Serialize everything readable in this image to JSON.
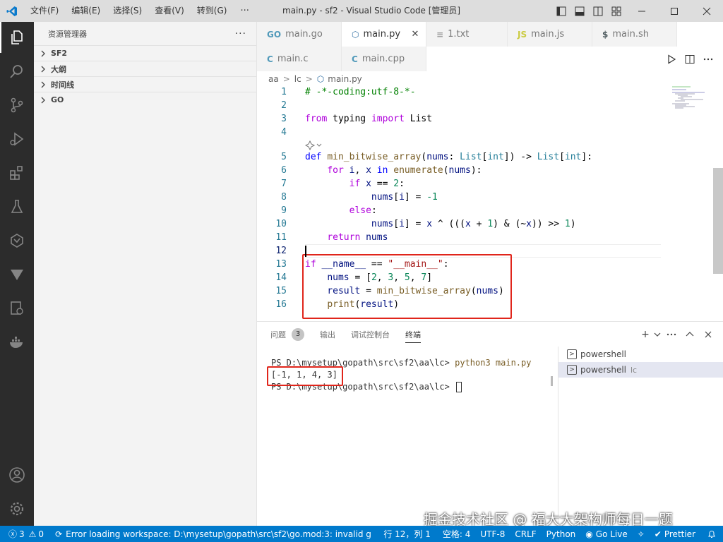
{
  "titlebar": {
    "menu": [
      "文件(F)",
      "编辑(E)",
      "选择(S)",
      "查看(V)",
      "转到(G)"
    ],
    "more": "···",
    "title": "main.py - sf2 - Visual Studio Code [管理员]"
  },
  "sidebar": {
    "title": "资源管理器",
    "more": "···",
    "sections": [
      "SF2",
      "大纲",
      "时间线",
      "GO"
    ]
  },
  "tabs": {
    "row1": [
      {
        "label": "main.go",
        "icon": "GO",
        "icon_color": "#519aba",
        "active": false
      },
      {
        "label": "main.py",
        "icon": "py",
        "icon_color": "#3572a5",
        "active": true
      },
      {
        "label": "1.txt",
        "icon": "≡",
        "icon_color": "#999999",
        "active": false
      },
      {
        "label": "main.js",
        "icon": "JS",
        "icon_color": "#cbcb41",
        "active": false
      },
      {
        "label": "main.sh",
        "icon": "$",
        "icon_color": "#4d5a5e",
        "active": false
      }
    ],
    "row2": [
      {
        "label": "main.c",
        "icon": "C",
        "icon_color": "#519aba",
        "active": false
      },
      {
        "label": "main.cpp",
        "icon": "C",
        "icon_color": "#519aba",
        "active": false
      }
    ]
  },
  "breadcrumb": [
    "aa",
    "lc",
    "main.py"
  ],
  "editor": {
    "lines": [
      {
        "n": "1",
        "tokens": [
          [
            "cmt",
            "# -*-coding:utf-8-*-"
          ]
        ]
      },
      {
        "n": "2",
        "tokens": []
      },
      {
        "n": "3",
        "tokens": [
          [
            "kw2",
            "from"
          ],
          [
            "",
            " typing "
          ],
          [
            "kw2",
            "import"
          ],
          [
            "",
            " List"
          ]
        ]
      },
      {
        "n": "4",
        "tokens": []
      },
      {
        "n": "5",
        "tokens": [
          [
            "kw",
            "def"
          ],
          [
            "",
            " "
          ],
          [
            "fn",
            "min_bitwise_array"
          ],
          [
            "",
            "("
          ],
          [
            "var",
            "nums"
          ],
          [
            "",
            ": "
          ],
          [
            "ty",
            "List"
          ],
          [
            "",
            "["
          ],
          [
            "ty",
            "int"
          ],
          [
            "",
            "]) -> "
          ],
          [
            "ty",
            "List"
          ],
          [
            "",
            "["
          ],
          [
            "ty",
            "int"
          ],
          [
            "",
            "]:"
          ]
        ]
      },
      {
        "n": "6",
        "tokens": [
          [
            "",
            "    "
          ],
          [
            "kw2",
            "for"
          ],
          [
            "",
            " "
          ],
          [
            "var",
            "i"
          ],
          [
            "",
            ", "
          ],
          [
            "var",
            "x"
          ],
          [
            "",
            " "
          ],
          [
            "kw",
            "in"
          ],
          [
            "",
            " "
          ],
          [
            "fn",
            "enumerate"
          ],
          [
            "",
            "("
          ],
          [
            "var",
            "nums"
          ],
          [
            "",
            "):"
          ]
        ]
      },
      {
        "n": "7",
        "tokens": [
          [
            "",
            "        "
          ],
          [
            "kw2",
            "if"
          ],
          [
            "",
            " "
          ],
          [
            "var",
            "x"
          ],
          [
            "",
            " == "
          ],
          [
            "num",
            "2"
          ],
          [
            "",
            ":"
          ]
        ]
      },
      {
        "n": "8",
        "tokens": [
          [
            "",
            "            "
          ],
          [
            "var",
            "nums"
          ],
          [
            "",
            "["
          ],
          [
            "var",
            "i"
          ],
          [
            "",
            "] = "
          ],
          [
            "num",
            "-1"
          ]
        ]
      },
      {
        "n": "9",
        "tokens": [
          [
            "",
            "        "
          ],
          [
            "kw2",
            "else"
          ],
          [
            "",
            ":"
          ]
        ]
      },
      {
        "n": "10",
        "tokens": [
          [
            "",
            "            "
          ],
          [
            "var",
            "nums"
          ],
          [
            "",
            "["
          ],
          [
            "var",
            "i"
          ],
          [
            "",
            "] = "
          ],
          [
            "var",
            "x"
          ],
          [
            "",
            " ^ ((("
          ],
          [
            "var",
            "x"
          ],
          [
            "",
            " + "
          ],
          [
            "num",
            "1"
          ],
          [
            "",
            ") & (~"
          ],
          [
            "var",
            "x"
          ],
          [
            "",
            ")) >> "
          ],
          [
            "num",
            "1"
          ],
          [
            "",
            ")"
          ]
        ]
      },
      {
        "n": "11",
        "tokens": [
          [
            "",
            "    "
          ],
          [
            "kw2",
            "return"
          ],
          [
            "",
            " "
          ],
          [
            "var",
            "nums"
          ]
        ]
      },
      {
        "n": "12",
        "tokens": []
      },
      {
        "n": "13",
        "tokens": [
          [
            "kw2",
            "if"
          ],
          [
            "",
            " "
          ],
          [
            "var",
            "__name__"
          ],
          [
            "",
            " == "
          ],
          [
            "str",
            "\"__main__\""
          ],
          [
            "",
            ":"
          ]
        ]
      },
      {
        "n": "14",
        "tokens": [
          [
            "",
            "    "
          ],
          [
            "var",
            "nums"
          ],
          [
            "",
            " = ["
          ],
          [
            "num",
            "2"
          ],
          [
            "",
            ", "
          ],
          [
            "num",
            "3"
          ],
          [
            "",
            ", "
          ],
          [
            "num",
            "5"
          ],
          [
            "",
            ", "
          ],
          [
            "num",
            "7"
          ],
          [
            "",
            "]"
          ]
        ]
      },
      {
        "n": "15",
        "tokens": [
          [
            "",
            "    "
          ],
          [
            "var",
            "result"
          ],
          [
            "",
            " = "
          ],
          [
            "fn",
            "min_bitwise_array"
          ],
          [
            "",
            "("
          ],
          [
            "var",
            "nums"
          ],
          [
            "",
            ")"
          ]
        ]
      },
      {
        "n": "16",
        "tokens": [
          [
            "",
            "    "
          ],
          [
            "fn",
            "print"
          ],
          [
            "",
            "("
          ],
          [
            "var",
            "result"
          ],
          [
            "",
            ")"
          ]
        ]
      }
    ],
    "current_line": "12"
  },
  "panel": {
    "tabs": [
      "问题",
      "输出",
      "调试控制台",
      "终端"
    ],
    "problems_count": "3",
    "active_tab": "终端",
    "terminal": {
      "prompt1": "PS D:\\mysetup\\gopath\\src\\sf2\\aa\\lc> ",
      "cmd1": "python3 main.py",
      "output": "[-1, 1, 4, 3]",
      "prompt2": "PS D:\\mysetup\\gopath\\src\\sf2\\aa\\lc> "
    },
    "terminals": [
      {
        "label": "powershell",
        "sub": "",
        "selected": false
      },
      {
        "label": "powershell",
        "sub": "lc",
        "selected": true
      }
    ]
  },
  "watermark": "掘金技术社区 @ 福大大架构师每日一题",
  "statusbar": {
    "errors": "3",
    "warnings": "0",
    "message": "Error loading workspace: D:\\mysetup\\gopath\\src\\sf2\\go.mod:3: invalid g",
    "position": "行 12，列 1",
    "spaces": "空格: 4",
    "encoding": "UTF-8",
    "eol": "CRLF",
    "language": "Python",
    "golive": "Go Live",
    "prettier": "Prettier"
  },
  "colors": {
    "accent": "#007acc",
    "highlight_box": "#e0251b"
  }
}
